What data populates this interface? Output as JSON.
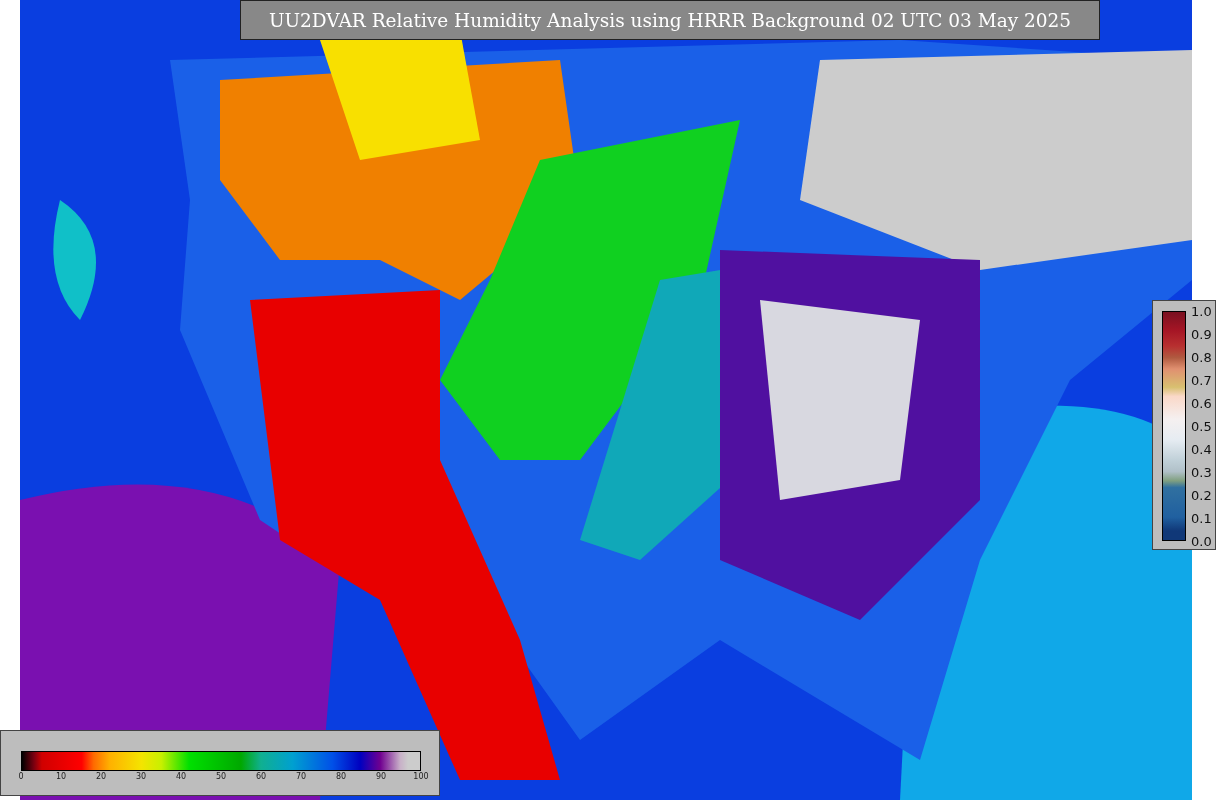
{
  "title": "UU2DVAR Relative Humidity Analysis using HRRR Background 02 UTC 03 May 2025",
  "humidity_colorbar": {
    "ticks": [
      "0",
      "10",
      "20",
      "30",
      "40",
      "50",
      "60",
      "70",
      "80",
      "90",
      "100"
    ]
  },
  "side_colorbar": {
    "ticks": [
      "1.0",
      "0.9",
      "0.8",
      "0.7",
      "0.6",
      "0.5",
      "0.4",
      "0.3",
      "0.2",
      "0.1",
      "0.0"
    ]
  }
}
